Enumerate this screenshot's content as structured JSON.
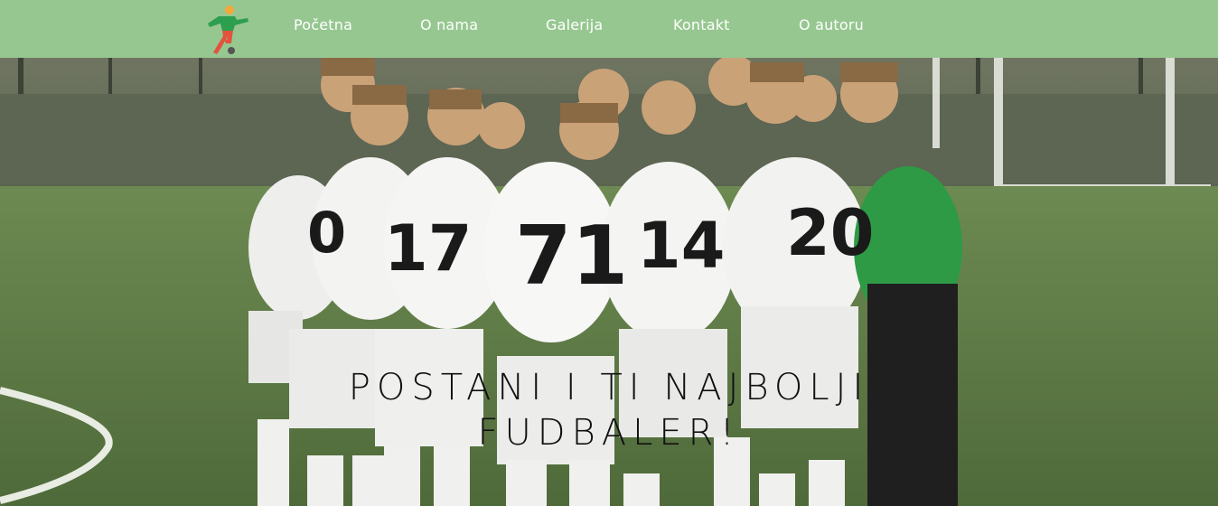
{
  "nav": {
    "items": [
      {
        "label": "Početna"
      },
      {
        "label": "O nama"
      },
      {
        "label": "Galerija"
      },
      {
        "label": "Kontakt"
      },
      {
        "label": "O autoru"
      }
    ]
  },
  "hero": {
    "title_line1": "POSTANI I TI NAJBOLJI",
    "title_line2": "FUDBALER!"
  },
  "colors": {
    "navbar": "#96c790",
    "nav_text": "#ffffff",
    "title_text": "#111111"
  }
}
